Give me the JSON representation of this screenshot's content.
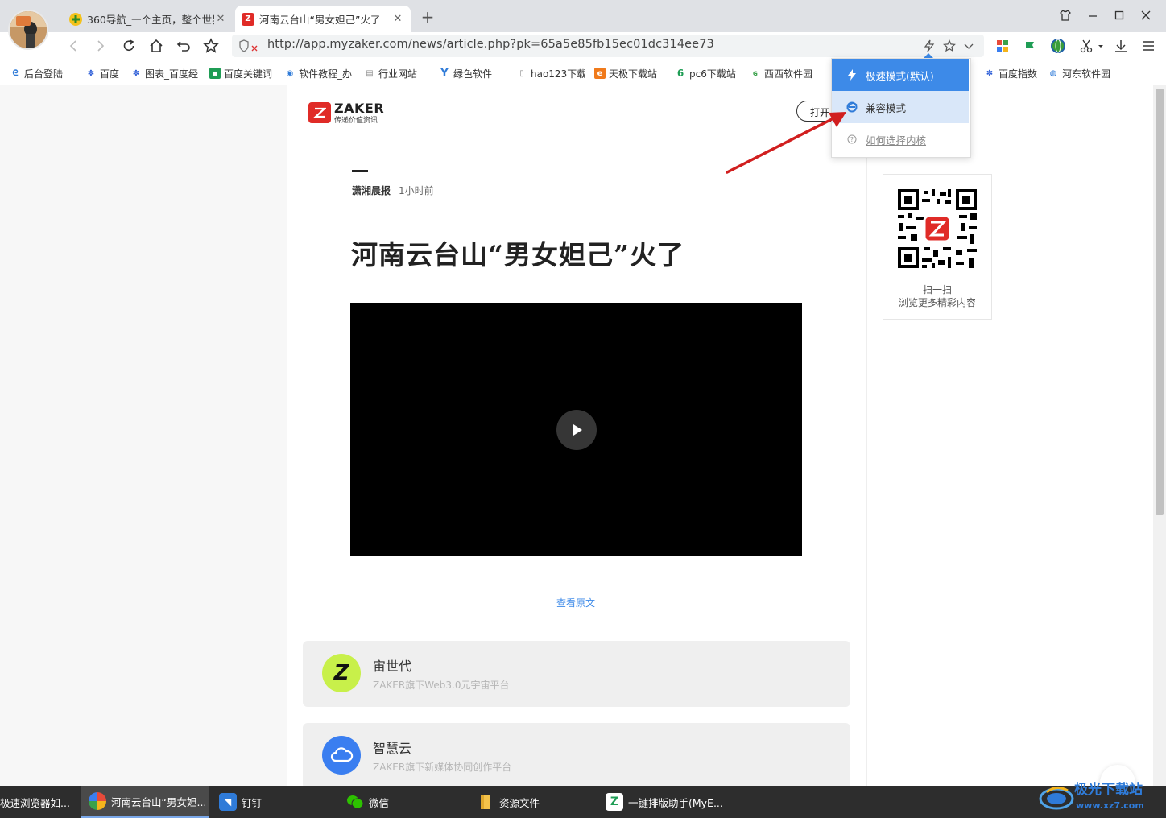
{
  "tabs": [
    {
      "title": "360导航_一个主页，整个世界",
      "active": false
    },
    {
      "title": "河南云台山“男女妲己”火了",
      "active": true
    }
  ],
  "address_bar": {
    "url": "http://app.myzaker.com/news/article.php?pk=65a5e85fb15ec01dc314ee73"
  },
  "bookmarks": [
    {
      "label": "后台登陆",
      "icon": "swirl-icon"
    },
    {
      "label": "百度",
      "icon": "baidu-paw-icon"
    },
    {
      "label": "图表_百度经",
      "icon": "baidu-paw-icon"
    },
    {
      "label": "百度关键词",
      "icon": "tag-icon"
    },
    {
      "label": "软件教程_办",
      "icon": "eye-icon"
    },
    {
      "label": "行业网站",
      "icon": "doc-icon"
    },
    {
      "label": "绿色软件",
      "icon": "x-logo-icon"
    },
    {
      "label": "hao123下载",
      "icon": "doc-icon"
    },
    {
      "label": "天极下载站",
      "icon": "e-logo-icon"
    },
    {
      "label": "pc6下载站",
      "icon": "six-icon"
    },
    {
      "label": "西西软件园",
      "icon": "leaf-icon"
    },
    {
      "label": "百度指数",
      "icon": "baidu-paw-icon"
    },
    {
      "label": "河东软件园",
      "icon": "globe-icon"
    }
  ],
  "kernel_menu": {
    "items": [
      {
        "label": "极速模式(默认)",
        "icon": "lightning-icon",
        "state": "selected"
      },
      {
        "label": "兼容模式",
        "icon": "ie-icon",
        "state": "hover"
      },
      {
        "label": "如何选择内核",
        "icon": "help-icon",
        "state": "link"
      }
    ]
  },
  "article": {
    "logo_name": "ZAKER",
    "logo_slogan": "传递价值资讯",
    "open_button": "打开",
    "source": "潇湘晨报",
    "time": "1小时前",
    "title": "河南云台山“男女妲己”火了",
    "view_original": "查看原文"
  },
  "cards": [
    {
      "name": "宙世代",
      "desc": "ZAKER旗下Web3.0元宇宙平台",
      "icon_letter": "Z",
      "color": "#c8f04a"
    },
    {
      "name": "智慧云",
      "desc": "ZAKER旗下新媒体协同创作平台",
      "icon_letter": "",
      "color": "#3a7ef0"
    }
  ],
  "qr_box": {
    "line1": "扫一扫",
    "line2": "浏览更多精彩内容"
  },
  "taskbar": [
    {
      "label": "极速浏览器如...",
      "icon": "browser-icon"
    },
    {
      "label": "河南云台山“男女妲...",
      "icon": "chrome-like-icon"
    },
    {
      "label": "钉钉",
      "icon": "dingtalk-icon"
    },
    {
      "label": "微信",
      "icon": "wechat-icon"
    },
    {
      "label": "资源文件",
      "icon": "folder-icon"
    },
    {
      "label": "一键排版助手(MyE...",
      "icon": "layout-tool-icon"
    }
  ],
  "watermark": "极光下载站 www.xz7.com",
  "colors": {
    "accent_blue": "#3d8ae8",
    "zaker_red": "#e02b27",
    "link_blue": "#3d8ae8"
  }
}
